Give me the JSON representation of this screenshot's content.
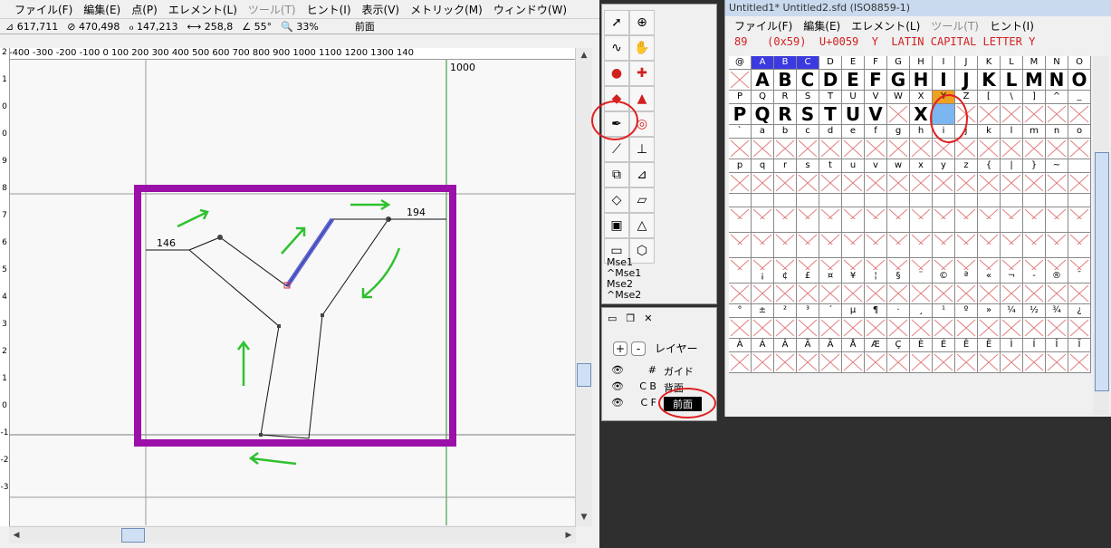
{
  "left_window": {
    "menu": [
      {
        "label": "ファイル(F)",
        "disabled": false
      },
      {
        "label": "編集(E)",
        "disabled": false
      },
      {
        "label": "点(P)",
        "disabled": false
      },
      {
        "label": "エレメント(L)",
        "disabled": false
      },
      {
        "label": "ツール(T)",
        "disabled": true
      },
      {
        "label": "ヒント(I)",
        "disabled": false
      },
      {
        "label": "表示(V)",
        "disabled": false
      },
      {
        "label": "メトリック(M)",
        "disabled": false
      },
      {
        "label": "ウィンドウ(W)",
        "disabled": false
      }
    ],
    "status": {
      "cursor_x": "617,711",
      "cursor_y": "470,498",
      "distance": "147,213",
      "width": "258,8",
      "angle": "55°",
      "zoom": "33%",
      "layer": "前面"
    },
    "ruler_labels": "-400 -300 -200 -100 0 100 200 300 400 500 600 700 800 900 1000 1100 1200 1300 140",
    "canvas": {
      "width_mark": "1000",
      "dim_left": "146",
      "dim_right": "194"
    }
  },
  "tool_palette": {
    "mse": [
      "Mse1",
      "^Mse1",
      "Mse2",
      "^Mse2"
    ]
  },
  "layers": {
    "title": "レイヤー",
    "add": "+",
    "remove": "-",
    "rows": [
      {
        "flags": "#",
        "name": "ガイド"
      },
      {
        "flags": "C B",
        "name": "背面"
      },
      {
        "flags": "C F",
        "name": "前面"
      }
    ]
  },
  "font_window": {
    "title": "Untitled1*  Untitled2.sfd (ISO8859-1)",
    "menu": [
      {
        "label": "ファイル(F)",
        "disabled": false
      },
      {
        "label": "編集(E)",
        "disabled": false
      },
      {
        "label": "エレメント(L)",
        "disabled": false
      },
      {
        "label": "ツール(T)",
        "disabled": true
      },
      {
        "label": "ヒント(I)",
        "disabled": false
      }
    ],
    "glyph_info": "89   (0x59)  U+0059  Y  LATIN CAPITAL LETTER Y",
    "rows": [
      [
        "@",
        "A",
        "B",
        "C",
        "D",
        "E",
        "F",
        "G",
        "H",
        "I",
        "J",
        "K",
        "L",
        "M",
        "N",
        "O"
      ],
      [
        "P",
        "Q",
        "R",
        "S",
        "T",
        "U",
        "V",
        "W",
        "X",
        "Y",
        "Z",
        "[",
        "\\",
        "]",
        "^",
        "_"
      ],
      [
        "`",
        "a",
        "b",
        "c",
        "d",
        "e",
        "f",
        "g",
        "h",
        "i",
        "j",
        "k",
        "l",
        "m",
        "n",
        "o"
      ],
      [
        "p",
        "q",
        "r",
        "s",
        "t",
        "u",
        "v",
        "w",
        "x",
        "y",
        "z",
        "{",
        "|",
        "}",
        "~",
        ""
      ],
      [
        "",
        "",
        "",
        "",
        "",
        "",
        "",
        "",
        "",
        "",
        "",
        "",
        "",
        "",
        "",
        ""
      ],
      [
        "",
        "",
        "",
        "",
        "",
        "",
        "",
        "",
        "",
        "",
        "",
        "",
        "",
        "",
        "",
        ""
      ],
      [
        "",
        "",
        "",
        "",
        "",
        "",
        "",
        "",
        "",
        "",
        "",
        "",
        "",
        "",
        "",
        ""
      ],
      [
        "",
        "¡",
        "¢",
        "£",
        "¤",
        "¥",
        "¦",
        "§",
        "¨",
        "©",
        "ª",
        "«",
        "¬",
        "-",
        "®",
        "¯"
      ],
      [
        "°",
        "±",
        "²",
        "³",
        "´",
        "µ",
        "¶",
        "·",
        "¸",
        "¹",
        "º",
        "»",
        "¼",
        "½",
        "¾",
        "¿"
      ],
      [
        "À",
        "Á",
        "Â",
        "Ã",
        "Ä",
        "Å",
        "Æ",
        "Ç",
        "È",
        "É",
        "Ê",
        "Ë",
        "Ì",
        "Í",
        "Î",
        "Ï"
      ]
    ],
    "filled_row0": [
      "A",
      "B",
      "C",
      "D",
      "E",
      "F",
      "G",
      "H",
      "I",
      "J",
      "K",
      "L",
      "M",
      "N",
      "O"
    ],
    "filled_row1": [
      "P",
      "Q",
      "R",
      "S",
      "T",
      "U",
      "V",
      "",
      "X"
    ]
  },
  "colors": {
    "accent_purple": "#9b10a8",
    "outline_blue": "#3d45c8",
    "arrow_green": "#2fc12f",
    "annotation_red": "#e02020",
    "selected_orange": "#f0a020",
    "selected_blue": "#7cb6f0"
  }
}
